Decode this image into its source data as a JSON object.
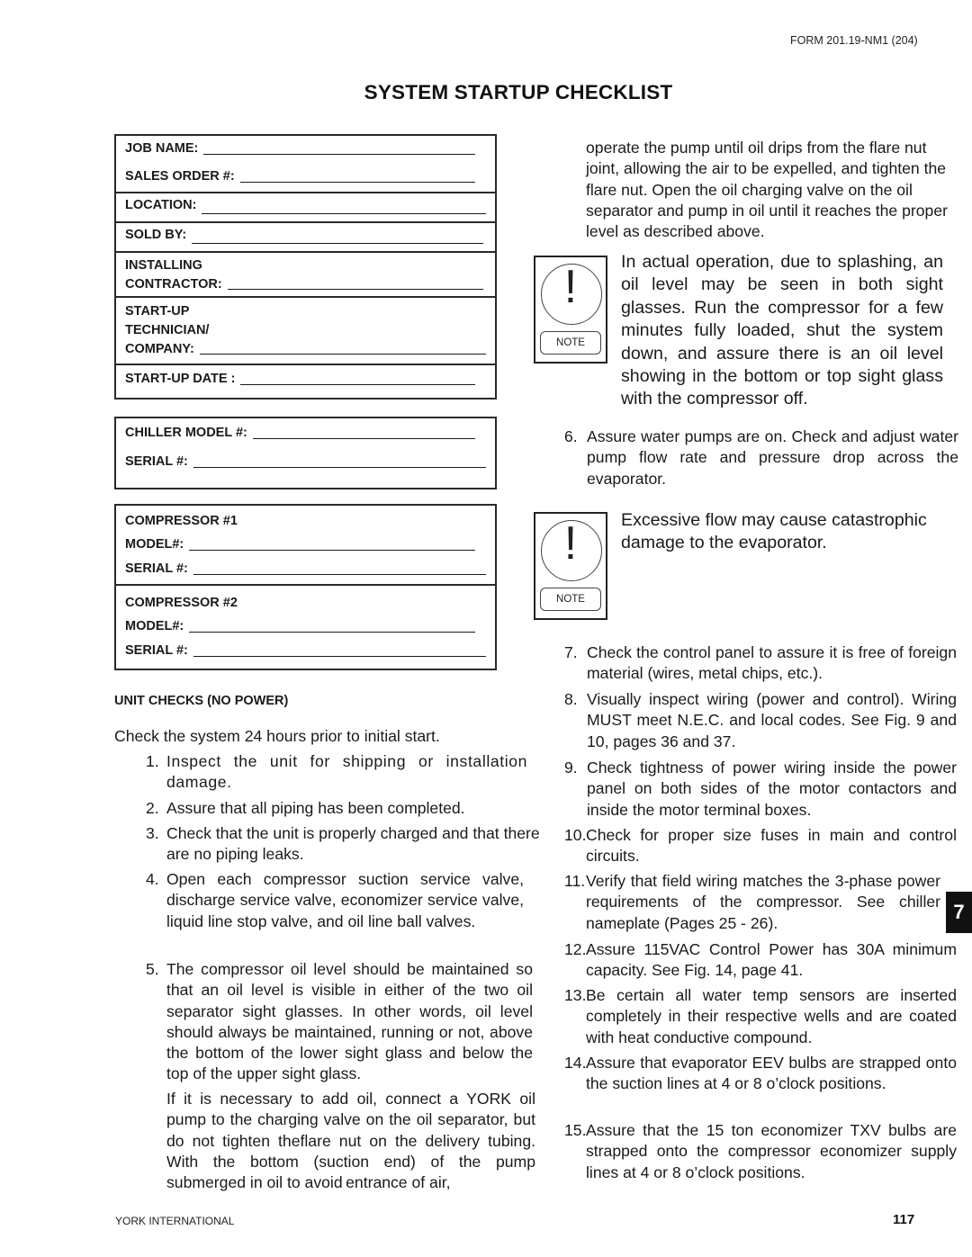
{
  "header": {
    "form_id": "FORM 201.19-NM1 (204)",
    "title": "SYSTEM STARTUP CHECKLIST"
  },
  "job_form": {
    "job_name": "JOB NAME:",
    "sales_order": "SALES ORDER #:",
    "location": "LOCATION:",
    "sold_by": "SOLD BY:",
    "installing": "INSTALLING",
    "contractor": "CONTRACTOR:",
    "startup": "START-UP",
    "technician": "TECHNICIAN/",
    "company": "COMPANY:",
    "startup_date": "START-UP DATE :"
  },
  "chiller_form": {
    "model": "CHILLER MODEL #:",
    "serial": "SERIAL #:"
  },
  "compressor_form": {
    "c1_title": "COMPRESSOR #1",
    "c1_model": "MODEL#:",
    "c1_serial": "SERIAL #:",
    "c2_title": "COMPRESSOR #2",
    "c2_model": "MODEL#:",
    "c2_serial": "SERIAL #:"
  },
  "unit_checks": {
    "heading": "UNIT CHECKS (NO POWER)",
    "intro": "Check the system 24 hours prior to initial start.",
    "items": [
      {
        "num": "1.",
        "text": "Inspect the unit for shipping or installation damage."
      },
      {
        "num": "2.",
        "text": "Assure that all piping has been completed."
      },
      {
        "num": "3.",
        "text": "Check that the unit is properly charged and that there are no piping leaks."
      },
      {
        "num": "4.",
        "text": "Open each compressor suction service valve, discharge service valve, economizer service valve, liquid line stop valve, and oil line ball valves."
      },
      {
        "num": "5.",
        "text": "The compressor oil level should be maintained so that an oil level is visible in either of the two oil separator sight glasses. In other words, oil level should always be maintained, running or not, above the bottom of the lower sight glass and below the top of the upper sight glass."
      },
      {
        "num": "",
        "text": "If it is necessary to add oil, connect a YORK oil pump to the charging valve on the oil separator, but do not tighten theﬂare nut on the delivery tubing. With the bottom (suction end) of the pump submerged in oil to avoid entrance of air,"
      }
    ],
    "continued": "operate the pump until oil drips from the ﬂare nut joint, allowing the air to be expelled, and tighten the ﬂare nut. Open the oil charging valve on the oil separator and pump in oil until it reaches the proper level as described above.",
    "note1": {
      "icon_label": "NOTE",
      "text": "In actual operation, due to splashing, an oil level may be seen in both sight glasses. Run the compressor for a few minutes fully loaded, shut the system down, and assure there is an oil level showing in the bottom or top sight glass with the compressor off."
    },
    "item6": {
      "num": "6.",
      "text": "Assure water pumps are on. Check and adjust water pump ﬂow rate and pressure drop across the evaporator."
    },
    "note2": {
      "icon_label": "NOTE",
      "text": "Excessive ﬂow may cause catastrophic damage to the evaporator."
    },
    "items_right": [
      {
        "num": "7.",
        "text": "Check the control panel to assure it is free of foreign material (wires, metal chips, etc.)."
      },
      {
        "num": "8.",
        "text": "Visually inspect wiring (power and control). Wiring MUST meet N.E.C. and local codes. See Fig. 9 and 10, pages 36 and 37."
      },
      {
        "num": "9.",
        "text": "Check tightness of power wiring inside the power panel on both sides of the motor contactors and inside the motor terminal boxes."
      },
      {
        "num": "10.",
        "text": "Check for proper size fuses in main and control circuits."
      },
      {
        "num": "11.",
        "text": "Verify that ﬁeld wiring matches the 3-phase power requirements of the compressor. See chiller nameplate (Pages 25 - 26)."
      },
      {
        "num": "12.",
        "text": "Assure 115VAC Control Power has 30A minimum capacity. See Fig. 14, page 41."
      },
      {
        "num": "13.",
        "text": "Be certain all water temp sensors are inserted completely in their respective wells and are coated with heat conductive compound."
      },
      {
        "num": "14.",
        "text": "Assure that evaporator EEV bulbs are strapped onto the suction lines at 4 or 8 o’clock positions."
      },
      {
        "num": "15.",
        "text": "Assure that the 15 ton economizer TXV bulbs are strapped onto the compressor economizer supply lines at 4 or 8 o’clock positions."
      }
    ]
  },
  "section_tab": "7",
  "footer": {
    "company": "YORK INTERNATIONAL",
    "page_number": "117"
  }
}
